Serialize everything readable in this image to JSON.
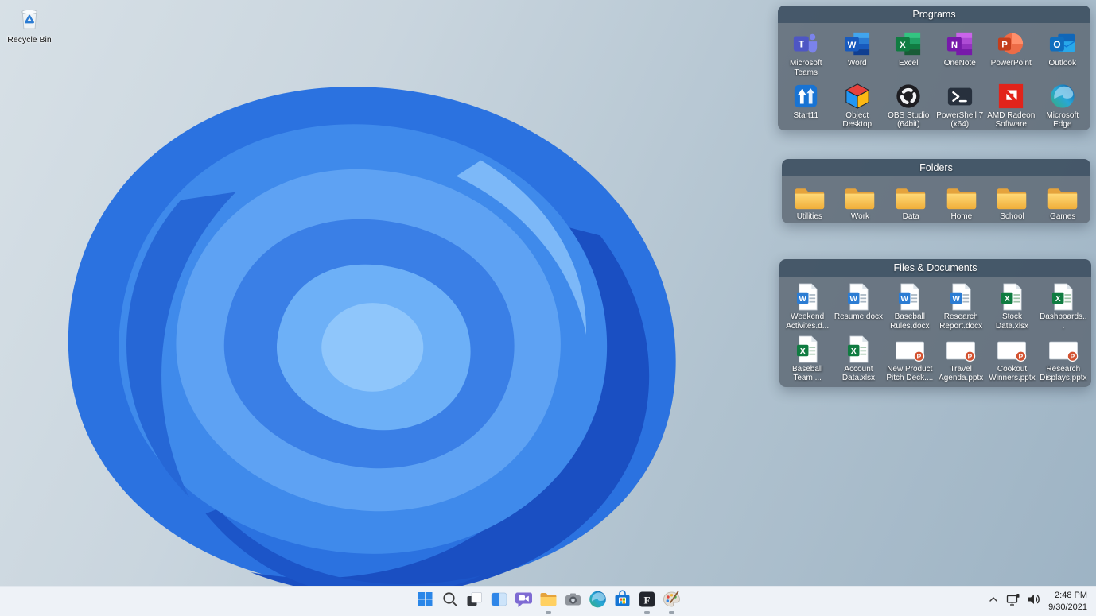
{
  "desktop": {
    "recycle_bin": {
      "label": "Recycle Bin"
    }
  },
  "fences": {
    "programs": {
      "title": "Programs",
      "items": [
        {
          "label": "Microsoft Teams",
          "icon": "teams"
        },
        {
          "label": "Word",
          "icon": "word"
        },
        {
          "label": "Excel",
          "icon": "excel"
        },
        {
          "label": "OneNote",
          "icon": "onenote"
        },
        {
          "label": "PowerPoint",
          "icon": "powerpoint"
        },
        {
          "label": "Outlook",
          "icon": "outlook"
        },
        {
          "label": "Start11",
          "icon": "start11"
        },
        {
          "label": "Object Desktop",
          "icon": "objectdesktop"
        },
        {
          "label": "OBS Studio (64bit)",
          "icon": "obs"
        },
        {
          "label": "PowerShell 7 (x64)",
          "icon": "powershell"
        },
        {
          "label": "AMD Radeon Software",
          "icon": "amd"
        },
        {
          "label": "Microsoft Edge",
          "icon": "edge"
        }
      ]
    },
    "folders": {
      "title": "Folders",
      "items": [
        {
          "label": "Utilities",
          "icon": "folder"
        },
        {
          "label": "Work",
          "icon": "folder"
        },
        {
          "label": "Data",
          "icon": "folder"
        },
        {
          "label": "Home",
          "icon": "folder"
        },
        {
          "label": "School",
          "icon": "folder"
        },
        {
          "label": "Games",
          "icon": "folder"
        }
      ]
    },
    "files": {
      "title": "Files & Documents",
      "items": [
        {
          "label": "Weekend Activites.d...",
          "icon": "worddoc"
        },
        {
          "label": "Resume.docx",
          "icon": "worddoc"
        },
        {
          "label": "Baseball Rules.docx",
          "icon": "worddoc"
        },
        {
          "label": "Research Report.docx",
          "icon": "worddoc"
        },
        {
          "label": "Stock Data.xlsx",
          "icon": "exceldoc"
        },
        {
          "label": "Dashboards...",
          "icon": "exceldoc"
        },
        {
          "label": "Baseball Team ...",
          "icon": "exceldoc"
        },
        {
          "label": "Account Data.xlsx",
          "icon": "exceldoc"
        },
        {
          "label": "New Product Pitch Deck....",
          "icon": "pptdoc"
        },
        {
          "label": "Travel Agenda.pptx",
          "icon": "pptdoc"
        },
        {
          "label": "Cookout Winners.pptx",
          "icon": "pptdoc"
        },
        {
          "label": "Research Displays.pptx",
          "icon": "pptdoc"
        }
      ]
    }
  },
  "taskbar": {
    "buttons": [
      {
        "name": "start",
        "running": false
      },
      {
        "name": "search",
        "running": false
      },
      {
        "name": "task-view",
        "running": false
      },
      {
        "name": "widgets",
        "running": false
      },
      {
        "name": "chat",
        "running": false
      },
      {
        "name": "file-explorer",
        "running": true
      },
      {
        "name": "camera",
        "running": false
      },
      {
        "name": "edge",
        "running": false
      },
      {
        "name": "store",
        "running": false
      },
      {
        "name": "fences",
        "running": true
      },
      {
        "name": "palette",
        "running": true
      }
    ],
    "tray": {
      "icons": [
        "chevron-up",
        "network",
        "volume"
      ],
      "time": "2:48 PM",
      "date": "9/30/2021"
    }
  },
  "theme": {
    "taskbar_bg": "#eef2f7",
    "fence_body": "rgba(93,104,116,0.83)",
    "fence_header": "rgba(56,76,96,0.72)",
    "wallpaper_blue": "#2b72e0",
    "folder_yellow": "#f3b53f"
  }
}
